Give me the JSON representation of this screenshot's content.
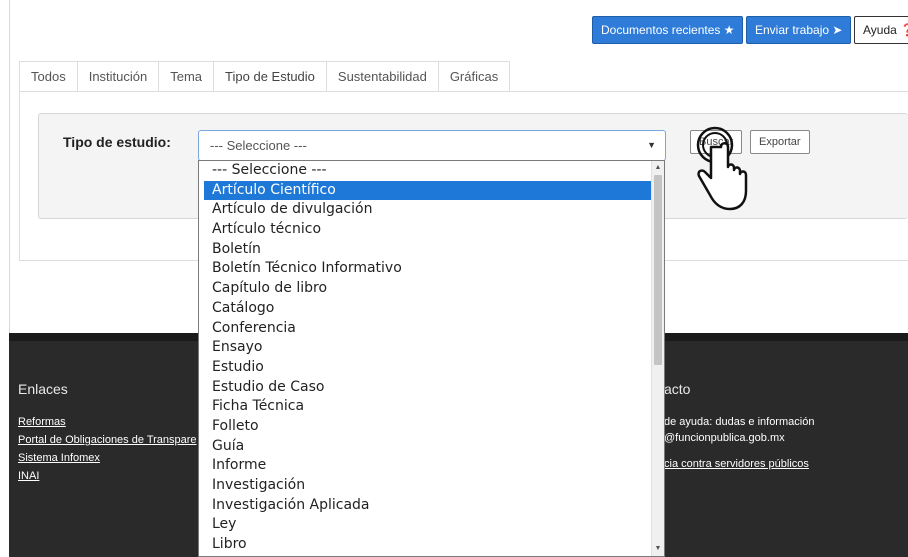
{
  "header": {
    "recent_docs": "Documentos recientes ★",
    "send_work": "Enviar trabajo ➤",
    "help": "Ayuda ❓"
  },
  "tabs": [
    {
      "label": "Todos"
    },
    {
      "label": "Institución"
    },
    {
      "label": "Tema"
    },
    {
      "label": "Tipo de Estudio"
    },
    {
      "label": "Sustentabilidad"
    },
    {
      "label": "Gráficas"
    }
  ],
  "filter": {
    "label": "Tipo de estudio:",
    "select_value": "--- Seleccione ---",
    "search_button": "Buscar",
    "export_button": "Exportar"
  },
  "dropdown": {
    "options": [
      "--- Seleccione ---",
      "Artículo Científico",
      "Artículo de divulgación",
      "Artículo técnico",
      "Boletín",
      "Boletín Técnico Informativo",
      "Capítulo de libro",
      "Catálogo",
      "Conferencia",
      "Ensayo",
      "Estudio",
      "Estudio de Caso",
      "Ficha Técnica",
      "Folleto",
      "Guía",
      "Informe",
      "Investigación",
      "Investigación Aplicada",
      "Ley",
      "Libro"
    ],
    "selected_index": 1
  },
  "footer": {
    "links_title": "Enlaces",
    "links": [
      "Reformas",
      "Portal de Obligaciones de Transpare",
      "Sistema Infomex",
      "INAI"
    ],
    "contact_title": "acto",
    "contact_line1": "de ayuda: dudas e información",
    "contact_line2": "@funcionpublica.gob.mx",
    "contact_link": "cia contra servidores públicos"
  },
  "colors": {
    "primary": "#2f7bd8",
    "selected": "#1e78d7",
    "footer_bg": "#2a2a2a"
  }
}
